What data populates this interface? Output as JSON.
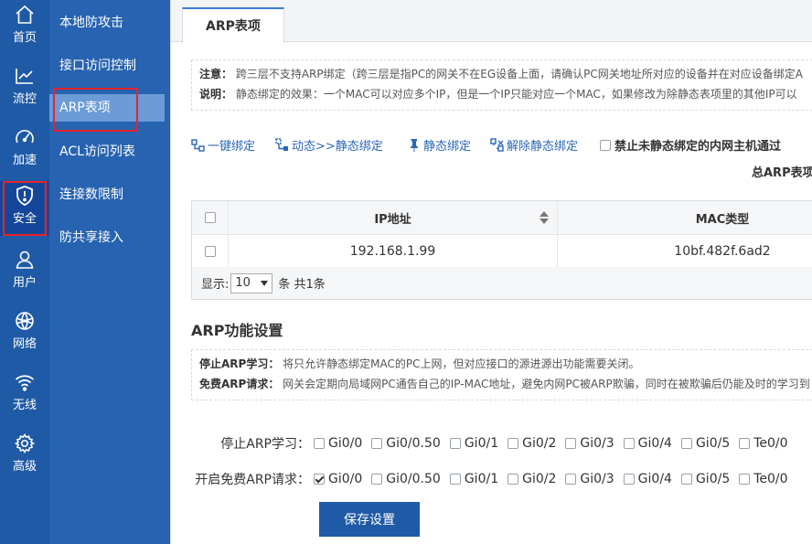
{
  "rail": [
    {
      "label": "首页",
      "icon": "home-icon"
    },
    {
      "label": "流控",
      "icon": "chart-icon"
    },
    {
      "label": "加速",
      "icon": "gauge-icon"
    },
    {
      "label": "安全",
      "icon": "shield-icon"
    },
    {
      "label": "用户",
      "icon": "user-icon"
    },
    {
      "label": "网络",
      "icon": "globe-icon"
    },
    {
      "label": "无线",
      "icon": "wifi-icon"
    },
    {
      "label": "高级",
      "icon": "gear-icon"
    }
  ],
  "submenu": [
    "本地防攻击",
    "接口访问控制",
    "ARP表项",
    "ACL访问列表",
    "连接数限制",
    "防共享接入"
  ],
  "tab": "ARP表项",
  "notes1": [
    {
      "k": "注意：",
      "t": "跨三层不支持ARP绑定（跨三层是指PC的网关不在EG设备上面，请确认PC网关地址所对应的设备并在对应设备绑定A"
    },
    {
      "k": "说明：",
      "t": "静态绑定的效果：一个MAC可以对应多个IP，但是一个IP只能对应一个MAC，如果修改为除静态表项里的其他IP可以"
    }
  ],
  "toolbar": {
    "one_click": "一键绑定",
    "dynamic_to_static": "动态>>静态绑定",
    "static_bind": "静态绑定",
    "unbind": "解除静态绑定",
    "block_label": "禁止未静态绑定的内网主机通过"
  },
  "total_label": "总ARP表项",
  "table": {
    "headers": {
      "ip": "IP地址",
      "mac": "MAC类型"
    },
    "rows": [
      {
        "ip": "192.168.1.99",
        "mac": "10bf.482f.6ad2"
      }
    ]
  },
  "footer": {
    "show": "显示:",
    "page_size": "10",
    "suffix": "条 共1条"
  },
  "section_title": "ARP功能设置",
  "notes2": [
    {
      "k": "停止ARP学习：",
      "t": "将只允许静态绑定MAC的PC上网，但对应接口的源进源出功能需要关闭。"
    },
    {
      "k": "免费ARP请求：",
      "t": "网关会定期向局域网PC通告自己的IP-MAC地址，避免内网PC被ARP欺骗，同时在被欺骗后仍能及时的学习到"
    }
  ],
  "stop_learning": {
    "label": "停止ARP学习：",
    "ports": [
      "Gi0/0",
      "Gi0/0.50",
      "Gi0/1",
      "Gi0/2",
      "Gi0/3",
      "Gi0/4",
      "Gi0/5",
      "Te0/0"
    ]
  },
  "free_arp": {
    "label": "开启免费ARP请求：",
    "ports": [
      "Gi0/0",
      "Gi0/0.50",
      "Gi0/1",
      "Gi0/2",
      "Gi0/3",
      "Gi0/4",
      "Gi0/5",
      "Te0/0"
    ],
    "checked": [
      "Gi0/0"
    ]
  },
  "save_label": "保存设置"
}
